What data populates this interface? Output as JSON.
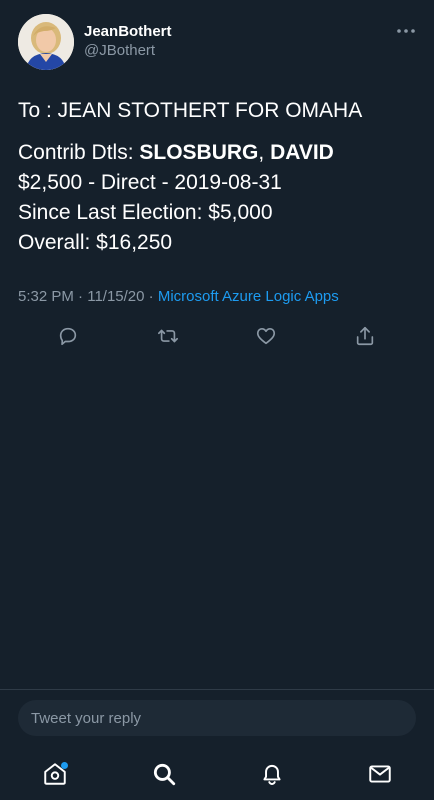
{
  "author": {
    "display_name": "JeanBothert",
    "handle": "@JBothert"
  },
  "header": {
    "more_icon": "more-horizontal-icon"
  },
  "tweet": {
    "line1": "To : JEAN STOTHERT FOR OMAHA",
    "line2_prefix": "Contrib Dtls: ",
    "line2_last": "SLOSBURG",
    "line2_sep": ", ",
    "line2_first": "DAVID",
    "line3": "$2,500 - Direct - 2019-08-31",
    "line4": "Since Last Election: $5,000",
    "line5": "Overall: $16,250"
  },
  "meta": {
    "time": "5:32 PM",
    "separator1": " · ",
    "date": "11/15/20",
    "separator2": " · ",
    "source": "Microsoft Azure Logic Apps"
  },
  "actions": {
    "reply_icon": "reply-icon",
    "retweet_icon": "retweet-icon",
    "like_icon": "heart-icon",
    "share_icon": "share-icon"
  },
  "reply": {
    "placeholder": "Tweet your reply"
  },
  "nav": {
    "home_icon": "home-icon",
    "search_icon": "search-icon",
    "notifications_icon": "bell-icon",
    "messages_icon": "mail-icon"
  },
  "colors": {
    "background": "#15202b",
    "accent": "#1d9bf0",
    "secondary_text": "#8b98a5"
  }
}
